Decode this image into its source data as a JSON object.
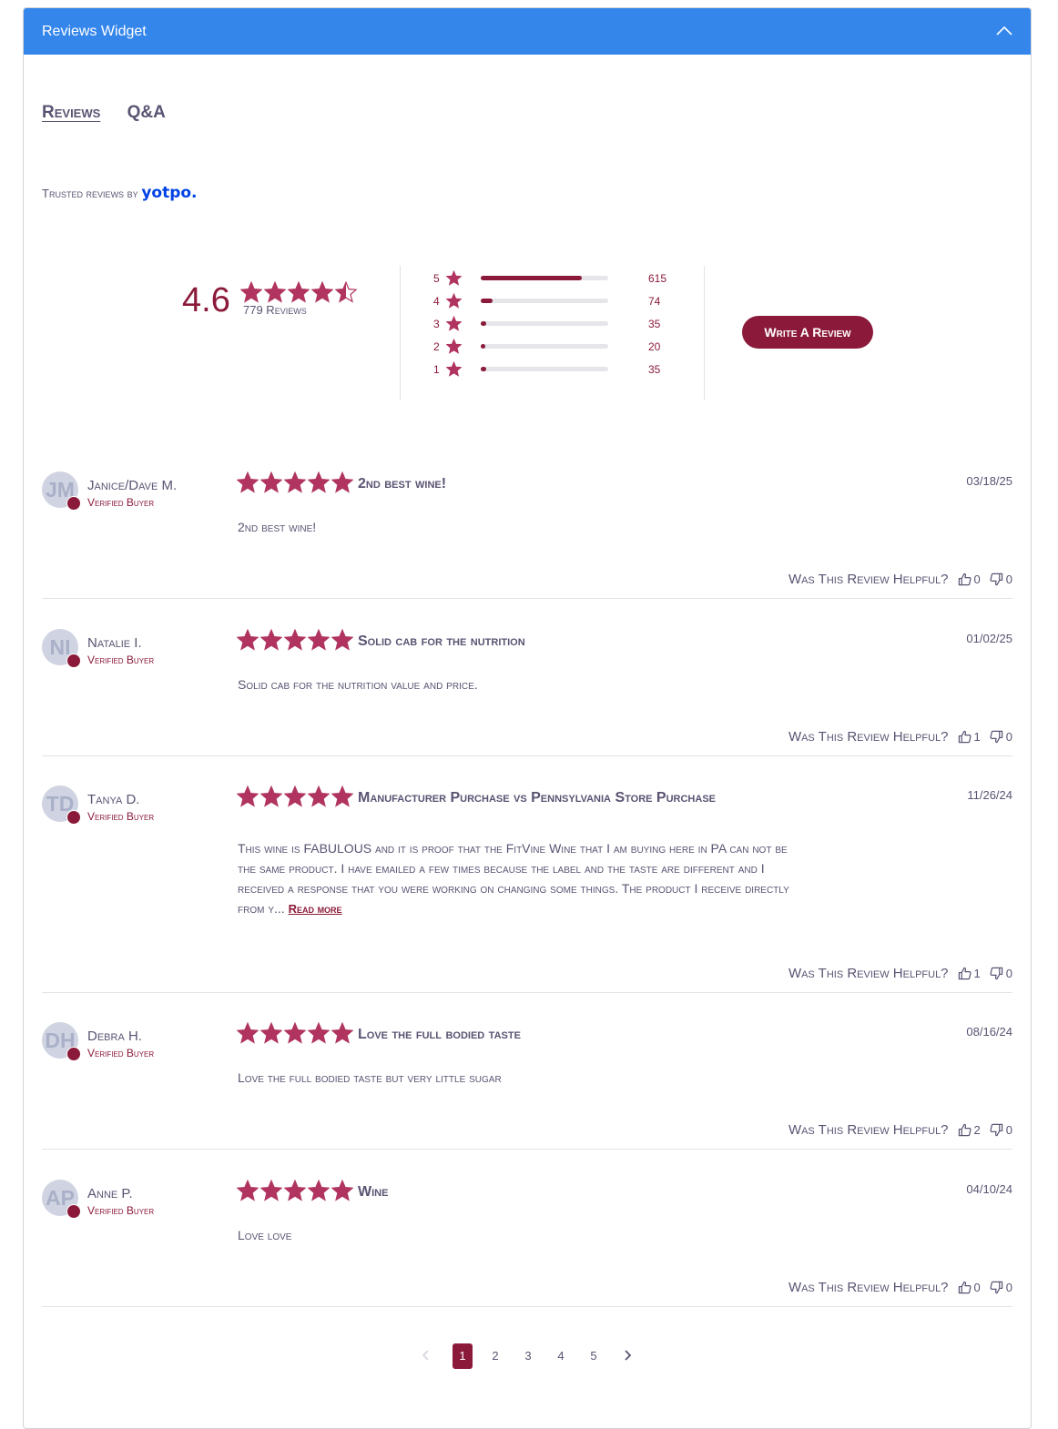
{
  "widget": {
    "title": "Reviews Widget"
  },
  "tabs": [
    {
      "label": "Reviews"
    },
    {
      "label": "Q&A"
    }
  ],
  "trusted": {
    "prefix": "Trusted reviews by",
    "brand": "yotpo."
  },
  "summary": {
    "average": "4.6",
    "average_value": 4.6,
    "total_label": "779 Reviews",
    "distribution": [
      {
        "stars": "5",
        "count": "615",
        "fraction": 0.79
      },
      {
        "stars": "4",
        "count": "74",
        "fraction": 0.095
      },
      {
        "stars": "3",
        "count": "35",
        "fraction": 0.045
      },
      {
        "stars": "2",
        "count": "20",
        "fraction": 0.026
      },
      {
        "stars": "1",
        "count": "35",
        "fraction": 0.045
      }
    ],
    "write_review_label": "Write A Review"
  },
  "reviews": [
    {
      "initials": "JM",
      "name": "Janice/Dave M.",
      "verified": "Verified Buyer",
      "rating": 5,
      "title": "2nd best wine!",
      "date": "03/18/25",
      "body": "2nd best wine!",
      "helpful_label": "Was This Review Helpful?",
      "up": "0",
      "down": "0"
    },
    {
      "initials": "NI",
      "name": "Natalie I.",
      "verified": "Verified Buyer",
      "rating": 5,
      "title": "Solid cab for the nutrition",
      "date": "01/02/25",
      "body": "Solid cab for the nutrition value and price.",
      "helpful_label": "Was This Review Helpful?",
      "up": "1",
      "down": "0"
    },
    {
      "initials": "TD",
      "name": "Tanya D.",
      "verified": "Verified Buyer",
      "rating": 5,
      "title": "Manufacturer Purchase vs Pennsylvania Store Purchase",
      "date": "11/26/24",
      "body": "This wine is FABULOUS and it is proof that the FitVine Wine that I am buying here in PA can not be the same product. I have emailed a few times because the label and the taste are different and I received a response that you were working on changing some things. The product I receive directly from y...",
      "read_more": "Read more",
      "helpful_label": "Was This Review Helpful?",
      "up": "1",
      "down": "0"
    },
    {
      "initials": "DH",
      "name": "Debra H.",
      "verified": "Verified Buyer",
      "rating": 5,
      "title": "Love the full bodied taste",
      "date": "08/16/24",
      "body": "Love the full bodied taste but very little sugar",
      "helpful_label": "Was This Review Helpful?",
      "up": "2",
      "down": "0"
    },
    {
      "initials": "AP",
      "name": "Anne P.",
      "verified": "Verified Buyer",
      "rating": 5,
      "title": "Wine",
      "date": "04/10/24",
      "body": "Love love",
      "helpful_label": "Was This Review Helpful?",
      "up": "0",
      "down": "0"
    }
  ],
  "pagination": {
    "pages": [
      "1",
      "2",
      "3",
      "4",
      "5"
    ],
    "current": "1"
  },
  "colors": {
    "header": "#3486eb",
    "accent": "#8b1a3a",
    "star": "#b0345f",
    "text": "#5a5372"
  },
  "icons": {
    "collapse": "chevron-up-icon",
    "star": "star-icon",
    "up": "thumbs-up-icon",
    "down": "thumbs-down-icon",
    "verified": "check-badge-icon",
    "prev": "chevron-left-icon",
    "next": "chevron-right-icon"
  }
}
